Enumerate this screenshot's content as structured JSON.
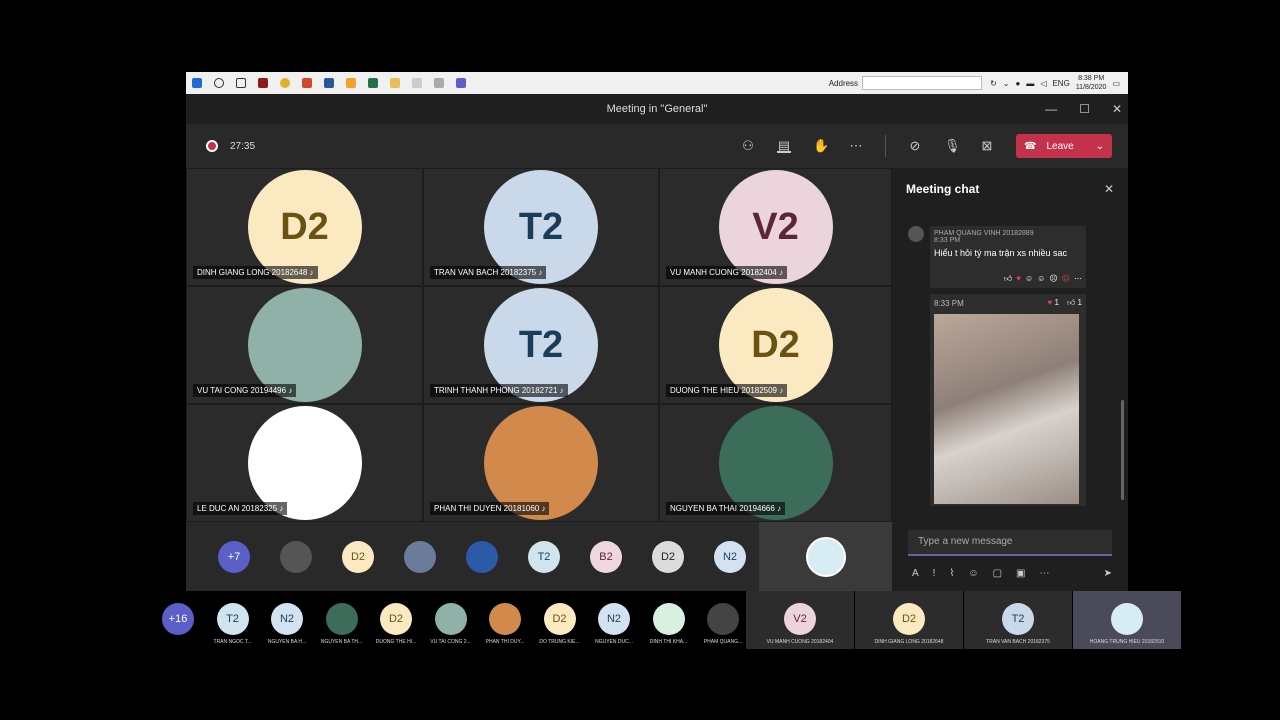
{
  "taskbar": {
    "address_label": "Address",
    "lang": "ENG",
    "time": "8:38 PM",
    "date": "11/8/2020"
  },
  "window": {
    "title": "Meeting in \"General\""
  },
  "controls": {
    "timer": "27:35",
    "leave_label": "Leave"
  },
  "tiles": [
    {
      "initials": "D2",
      "name": "DINH GIANG LONG 20182648",
      "bg": "#fbe9c2",
      "fg": "#6a5212"
    },
    {
      "initials": "T2",
      "name": "TRAN VAN BACH 20182375",
      "bg": "#c9d9ea",
      "fg": "#1c3d5a"
    },
    {
      "initials": "V2",
      "name": "VU MANH CUONG 20182404",
      "bg": "#ebd4dc",
      "fg": "#5d2638"
    },
    {
      "initials": "",
      "name": "VU TAI CONG 20194496",
      "bg": "#8fb1a8",
      "fg": "#fff"
    },
    {
      "initials": "T2",
      "name": "TRINH THANH PHONG 20182721",
      "bg": "#c9d9ea",
      "fg": "#1c3d5a"
    },
    {
      "initials": "D2",
      "name": "DUONG THE HIEU 20182509",
      "bg": "#fbe9c2",
      "fg": "#6a5212"
    },
    {
      "initials": "",
      "name": "LE DUC AN 20182325",
      "bg": "#ffffff",
      "fg": "#4e8a3c"
    },
    {
      "initials": "",
      "name": "PHAN THI DUYEN 20181060",
      "bg": "#d18a4c",
      "fg": "#fff"
    },
    {
      "initials": "",
      "name": "NGUYEN BA THAI 20194666",
      "bg": "#3c6d5a",
      "fg": "#fff"
    }
  ],
  "strip": [
    {
      "label": "+7",
      "bg": "#5b5fc7",
      "fg": "#fff"
    },
    {
      "label": "",
      "bg": "#555",
      "fg": "#fff"
    },
    {
      "label": "D2",
      "bg": "#fbe9c2",
      "fg": "#6a5212"
    },
    {
      "label": "",
      "bg": "#6b7c9a",
      "fg": "#fff"
    },
    {
      "label": "",
      "bg": "#2a5aa8",
      "fg": "#fff"
    },
    {
      "label": "T2",
      "bg": "#cfe4ec",
      "fg": "#1c3d5a"
    },
    {
      "label": "B2",
      "bg": "#f0d6e0",
      "fg": "#5d2638"
    },
    {
      "label": "D2",
      "bg": "#dcdcdc",
      "fg": "#222"
    },
    {
      "label": "N2",
      "bg": "#d3e2f0",
      "fg": "#1c3d5a"
    }
  ],
  "chat": {
    "title": "Meeting chat",
    "sender": "PHAM QUANG VINH 20182889",
    "time1": "8:33 PM",
    "text": "Hiểu t hỏi tý ma trận xs nhiều sac",
    "time2": "8:33 PM",
    "heart_count": "1",
    "like_count": "1",
    "placeholder": "Type a new message"
  },
  "outer": [
    {
      "label": "+16",
      "caption": "",
      "bg": "#5b5fc7",
      "fg": "#fff"
    },
    {
      "label": "T2",
      "caption": "TRAN NGOC T...",
      "bg": "#cfe4ec",
      "fg": "#1c3d5a"
    },
    {
      "label": "N2",
      "caption": "NGUYEN BA H...",
      "bg": "#d3e2f0",
      "fg": "#1c3d5a"
    },
    {
      "label": "",
      "caption": "NGUYEN BA TH...",
      "bg": "#3c6d5a",
      "fg": "#fff"
    },
    {
      "label": "D2",
      "caption": "DUONG THE HI...",
      "bg": "#fbe9c2",
      "fg": "#6a5212"
    },
    {
      "label": "",
      "caption": "VU TAI CONG 2...",
      "bg": "#8fb1a8",
      "fg": "#fff"
    },
    {
      "label": "",
      "caption": "PHAN THI DUY...",
      "bg": "#d18a4c",
      "fg": "#fff"
    },
    {
      "label": "D2",
      "caption": "DO TRUNG KIE...",
      "bg": "#fbe9c2",
      "fg": "#6a5212"
    },
    {
      "label": "N2",
      "caption": "NGUYEN DUC...",
      "bg": "#d3e2f0",
      "fg": "#1c3d5a"
    },
    {
      "label": "",
      "caption": "DINH THI KHA...",
      "bg": "#d9efe0",
      "fg": "#3a7a4a"
    },
    {
      "label": "",
      "caption": "PHAM QUANG...",
      "bg": "#444",
      "fg": "#fff"
    }
  ],
  "outer_panels": [
    {
      "label": "V2",
      "caption": "VU MANH CUONG 20182404",
      "bg": "#ebd4dc",
      "fg": "#5d2638"
    },
    {
      "label": "D2",
      "caption": "DINH GIANG LONG 20182648",
      "bg": "#fbe9c2",
      "fg": "#6a5212"
    },
    {
      "label": "T2",
      "caption": "TRAN VAN BACH 20182375",
      "bg": "#c9d9ea",
      "fg": "#1c3d5a"
    },
    {
      "label": "",
      "caption": "HOANG TRUNG HIEU 20182510",
      "bg": "#d8ecf3",
      "fg": "#3a7aa0"
    }
  ]
}
